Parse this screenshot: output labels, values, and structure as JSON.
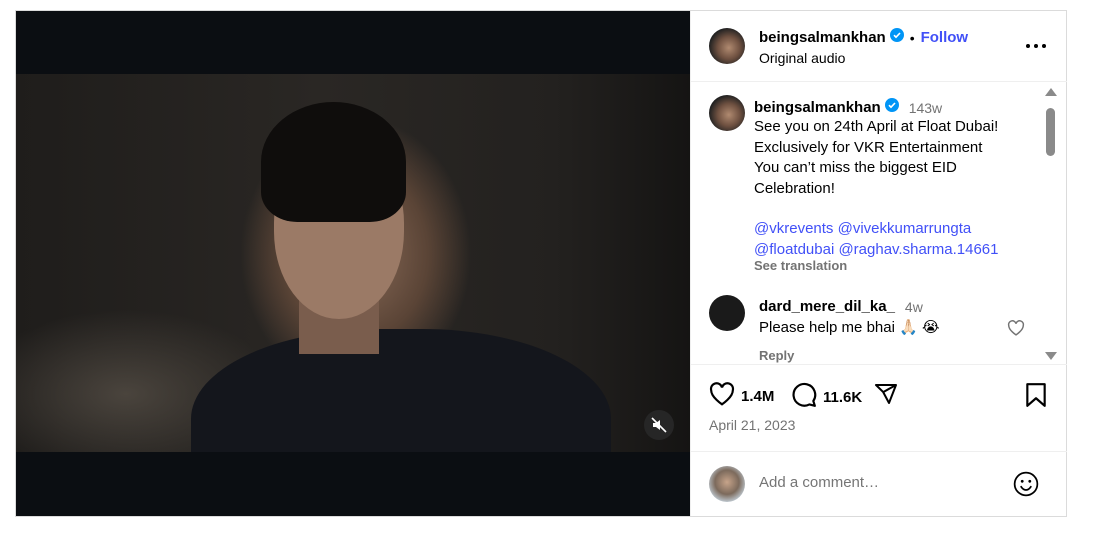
{
  "post": {
    "username": "beingsalmankhan",
    "follow_label": "Follow",
    "separator": "•",
    "audio": "Original audio",
    "caption": {
      "username": "beingsalmankhan",
      "time": "143w",
      "lines": [
        "See you on 24th April at Float Dubai!",
        "Exclusively for VKR Entertainment",
        "You can’t miss the biggest EID Celebration!"
      ],
      "mentions": [
        "@vkrevents",
        "@vivekkumarrungta",
        "@floatdubai",
        "@raghav.sharma.14661"
      ],
      "see_translation": "See translation"
    },
    "comment": {
      "username": "dard_mere_dil_ka_",
      "time": "4w",
      "text": "Please help me bhai",
      "emojis": "🙏🏻 😭",
      "reply": "Reply"
    },
    "likes": "1.4M",
    "comments": "11.6K",
    "date": "April 21, 2023",
    "add_comment_placeholder": "Add a comment…"
  },
  "colors": {
    "accent": "#4150f7",
    "verified": "#0095f6",
    "muted": "#737373"
  },
  "icons": [
    "verified-badge-icon",
    "more-options-icon",
    "heart-icon",
    "comment-icon",
    "share-icon",
    "bookmark-icon",
    "mute-icon",
    "emoji-icon"
  ]
}
